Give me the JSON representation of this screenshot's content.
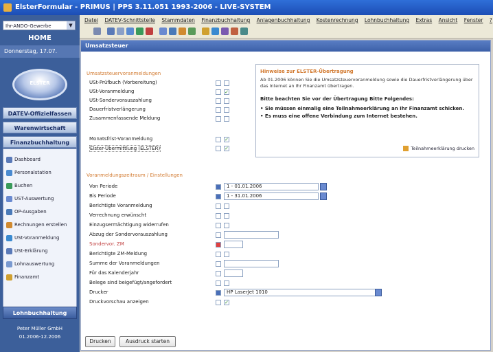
{
  "title": "ElsterFormular - PRIMUS | PPS 3.11.051 1993-2006 - LIVE-SYSTEM",
  "sidebar": {
    "combo_value": "Ihr-ANDO-Gewerbe",
    "home": "HOME",
    "date": "Donnerstag, 17.07.",
    "logo_text": "ELSTER",
    "nav": [
      "DATEV-Offizielfassen",
      "Warenwirtschaft",
      "Finanzbuchhaltung"
    ],
    "subitems": [
      {
        "label": "Dashboard",
        "color": "#5a7ab8"
      },
      {
        "label": "Personalstation",
        "color": "#4a8ad0"
      },
      {
        "label": "Buchen",
        "color": "#3a9a5a"
      },
      {
        "label": "UST-Auswertung",
        "color": "#6a8ad0"
      },
      {
        "label": "OP-Ausgaben",
        "color": "#4a7ab8"
      },
      {
        "label": "Rechnungen erstellen",
        "color": "#d08a30"
      },
      {
        "label": "USt-Voranmeldung",
        "color": "#3a8ad0"
      },
      {
        "label": "USt-Erklärung",
        "color": "#5a7ab8"
      },
      {
        "label": "Lohnauswertung",
        "color": "#7a9ad0"
      },
      {
        "label": "Finanzamt",
        "color": "#d0a030"
      }
    ],
    "bottom": "Lohnbuchhaltung",
    "user_line1": "Peter Müller GmbH",
    "user_line2": "01.2006-12.2006"
  },
  "menu": [
    "Datei",
    "DATEV-Schnittstelle",
    "Stammdaten",
    "Finanzbuchhaltung",
    "Anlagenbuchhaltung",
    "Kostenrechnung",
    "Lohnbuchhaltung",
    "Extras",
    "Ansicht",
    "Fenster",
    "?"
  ],
  "header": "Umsatzsteuer",
  "section1": "Umsatzsteuervoranmeldungen",
  "labels1": [
    "USt-Prüfbuch (Vorbereitung)",
    "USt-Voranmeldung",
    "USt-Sondervorauszahlung",
    "Dauerfristverlängerung",
    "Zusammenfassende Meldung"
  ],
  "labels1b": [
    "Monatsfrist-Voranmeldung",
    "Elster-Übermittlung (ELSTER)"
  ],
  "checked1": [
    false,
    true,
    false,
    false,
    false
  ],
  "checked1b": [
    true,
    true
  ],
  "info": {
    "title": "Hinweise zur ELSTER-Übertragung",
    "text": "Ab 01.2006 können Sie die Umsatzsteuervoranmeldung sowie die Dauerfristverlängerung über das Internet an Ihr Finanzamt übertragen.",
    "bold": "Bitte beachten Sie vor der Übertragung Bitte Folgendes:",
    "bullet1": "Sie müssen einmalig eine Teilnahmeerklärung an Ihr Finanzamt schicken.",
    "bullet2": "Es muss eine offene Verbindung zum Internet bestehen.",
    "link": "Teilnahmeerklärung drucken"
  },
  "section2": "Voranmeldungszeitraum / Einstellungen",
  "labels2": [
    "Von Periode",
    "Bis Periode",
    "Berichtigte Voranmeldung",
    "Verrechnung erwünscht",
    "Einzugsermächtigung widerrufen",
    "Abzug der Sondervorauszahlung",
    "Sondervor. ZM",
    "Berichtigte ZM-Meldung",
    "Summe der Voranmeldungen",
    "Für das Kalenderjahr",
    "Belege sind beigefügt/angefordert",
    "Drucker",
    "Druckvorschau anzeigen"
  ],
  "from_date": "1 - 01.01.2006",
  "to_date": "1 - 31.01.2006",
  "printer": "HP LaserJet 1010",
  "buttons": {
    "print": "Drucken",
    "output": "Ausdruck starten"
  }
}
